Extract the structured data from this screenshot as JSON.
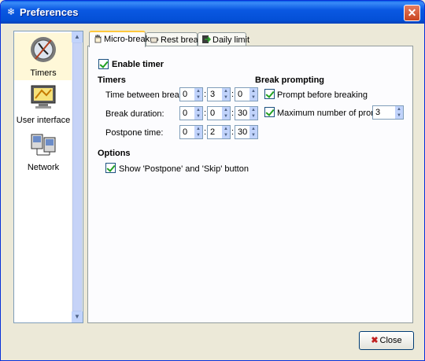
{
  "window": {
    "title": "Preferences"
  },
  "sidebar": {
    "items": [
      {
        "label": "Timers",
        "icon": "clock-icon",
        "selected": true
      },
      {
        "label": "User interface",
        "icon": "monitor-icon",
        "selected": false
      },
      {
        "label": "Network",
        "icon": "network-icon",
        "selected": false
      }
    ]
  },
  "tabs": [
    {
      "label": "Micro-break",
      "icon": "hand-icon",
      "active": true
    },
    {
      "label": "Rest break",
      "icon": "cup-icon",
      "active": false
    },
    {
      "label": "Daily limit",
      "icon": "exit-icon",
      "active": false
    }
  ],
  "timer": {
    "enable_label": "Enable timer",
    "enabled": true
  },
  "timers_section": {
    "heading": "Timers",
    "rows": [
      {
        "label": "Time between breaks:",
        "h": "0",
        "m": "3",
        "s": "0"
      },
      {
        "label": "Break duration:",
        "h": "0",
        "m": "0",
        "s": "30"
      },
      {
        "label": "Postpone time:",
        "h": "0",
        "m": "2",
        "s": "30"
      }
    ],
    "sep": ":"
  },
  "prompting": {
    "heading": "Break prompting",
    "prompt_before_label": "Prompt before breaking",
    "prompt_before_checked": true,
    "max_prompts_label": "Maximum number of prompts:",
    "max_prompts_checked": true,
    "max_prompts_value": "3"
  },
  "options": {
    "heading": "Options",
    "show_buttons_label": "Show 'Postpone' and 'Skip' button",
    "show_buttons_checked": true
  },
  "footer": {
    "close_label": "Close"
  },
  "colors": {
    "titlebar": "#0A58E2",
    "accent_tab": "#FFC83C",
    "check": "#21A121",
    "bg": "#ECE9D8"
  }
}
